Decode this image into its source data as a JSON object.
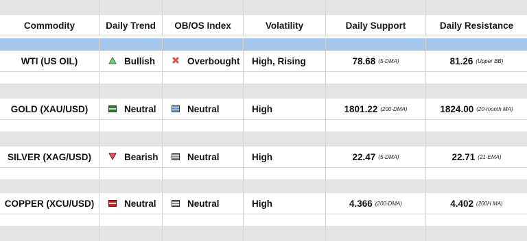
{
  "headers": [
    "Commodity",
    "Daily Trend",
    "OB/OS Index",
    "Volatility",
    "Daily Support",
    "Daily Resistance"
  ],
  "colors": {
    "bullish": "#5cb85c",
    "bearish": "#d9534f",
    "neutral_green": "#2e7d32",
    "neutral_red": "#c62828",
    "neutral_blue": "#6b8fbf",
    "neutral_gray": "#8c8c8c",
    "overbought": "#d9534f"
  },
  "rows": [
    {
      "commodity": "WTI (US OIL)",
      "trend": "Bullish",
      "trend_icon": "triangle-up-icon",
      "obos": "Overbought",
      "obos_icon": "x-icon",
      "volatility": "High, Rising",
      "support": "78.68",
      "support_note": "(5-DMA)",
      "resistance": "81.26",
      "resistance_note": "(Upper BB)"
    },
    {
      "commodity": "GOLD (XAU/USD)",
      "trend": "Neutral",
      "trend_icon": "bars-green-icon",
      "obos": "Neutral",
      "obos_icon": "bars-blue-icon",
      "volatility": "High",
      "support": "1801.22",
      "support_note": "(200-DMA)",
      "resistance": "1824.00",
      "resistance_note": "(20-month MA)"
    },
    {
      "commodity": "SILVER (XAG/USD)",
      "trend": "Bearish",
      "trend_icon": "triangle-down-icon",
      "obos": "Neutral",
      "obos_icon": "bars-gray-icon",
      "volatility": "High",
      "support": "22.47",
      "support_note": "(5-DMA)",
      "resistance": "22.71",
      "resistance_note": "(21-EMA)"
    },
    {
      "commodity": "COPPER (XCU/USD)",
      "trend": "Neutral",
      "trend_icon": "bars-red-icon",
      "obos": "Neutral",
      "obos_icon": "bars-gray-icon",
      "volatility": "High",
      "support": "4.366",
      "support_note": "(200-DMA)",
      "resistance": "4.402",
      "resistance_note": "(200H MA)"
    }
  ]
}
